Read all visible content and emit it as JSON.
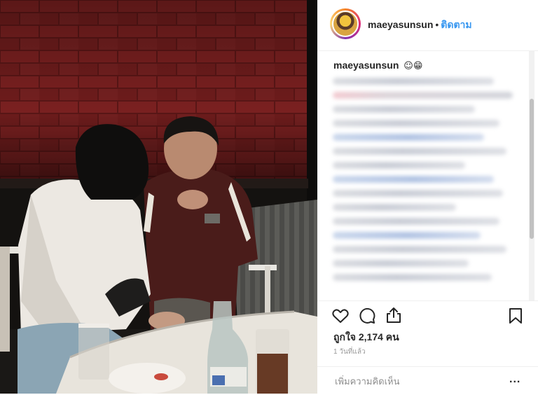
{
  "post": {
    "username": "maeyasunsun",
    "separator": "•",
    "follow_label": "ติดตาม",
    "caption_text": "☺",
    "caption_emoji": "😁",
    "likes_label": "ถูกใจ 2,174 คน",
    "time_label": "1 วันที่แล้ว",
    "comment_placeholder": "เพิ่มความคิดเห็น",
    "more_label": "..."
  },
  "icons": {
    "like": "heart-icon",
    "comment": "comment-bubble-icon",
    "share": "share-icon",
    "save": "bookmark-icon",
    "more": "ellipsis-icon"
  },
  "colors": {
    "follow_blue": "#3897f0",
    "text": "#262626",
    "muted": "#999999"
  }
}
